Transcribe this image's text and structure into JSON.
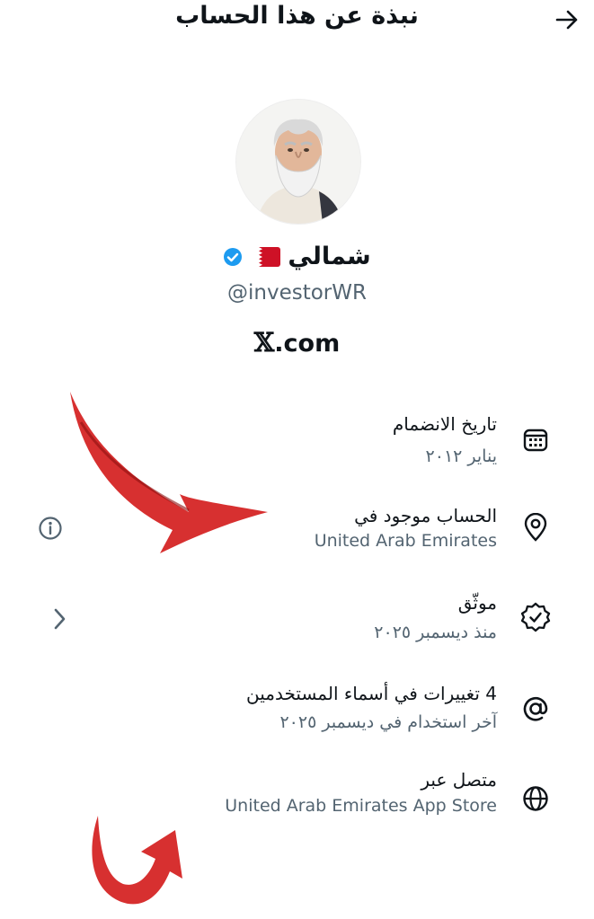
{
  "header": {
    "title": "نبذة عن هذا الحساب"
  },
  "profile": {
    "name": "شمالي",
    "handle": "@investorWR"
  },
  "brand": {
    "x_mark": "𝕏",
    "domain": ".com"
  },
  "rows": [
    {
      "icon": "calendar-icon",
      "title": "تاريخ الانضمام",
      "subtitle": "يناير ٢٠١٢"
    },
    {
      "icon": "location-pin-icon",
      "title": "الحساب موجود في",
      "subtitle": "United Arab Emirates",
      "side": "info-icon"
    },
    {
      "icon": "verified-badge-icon",
      "title": "موثّق",
      "subtitle": "منذ ديسمبر ٢٠٢٥",
      "side": "chevron-right-icon"
    },
    {
      "icon": "at-sign-icon",
      "title": "4 تغييرات في أسماء المستخدمين",
      "subtitle": "آخر استخدام في ديسمبر ٢٠٢٥"
    },
    {
      "icon": "globe-icon",
      "title": "متصل عبر",
      "subtitle": "United Arab Emirates App Store"
    }
  ],
  "colors": {
    "verified": "#1d9bf0",
    "flag_red": "#ce1126",
    "annotation_red": "#d41e1e",
    "muted_text": "#536471"
  }
}
